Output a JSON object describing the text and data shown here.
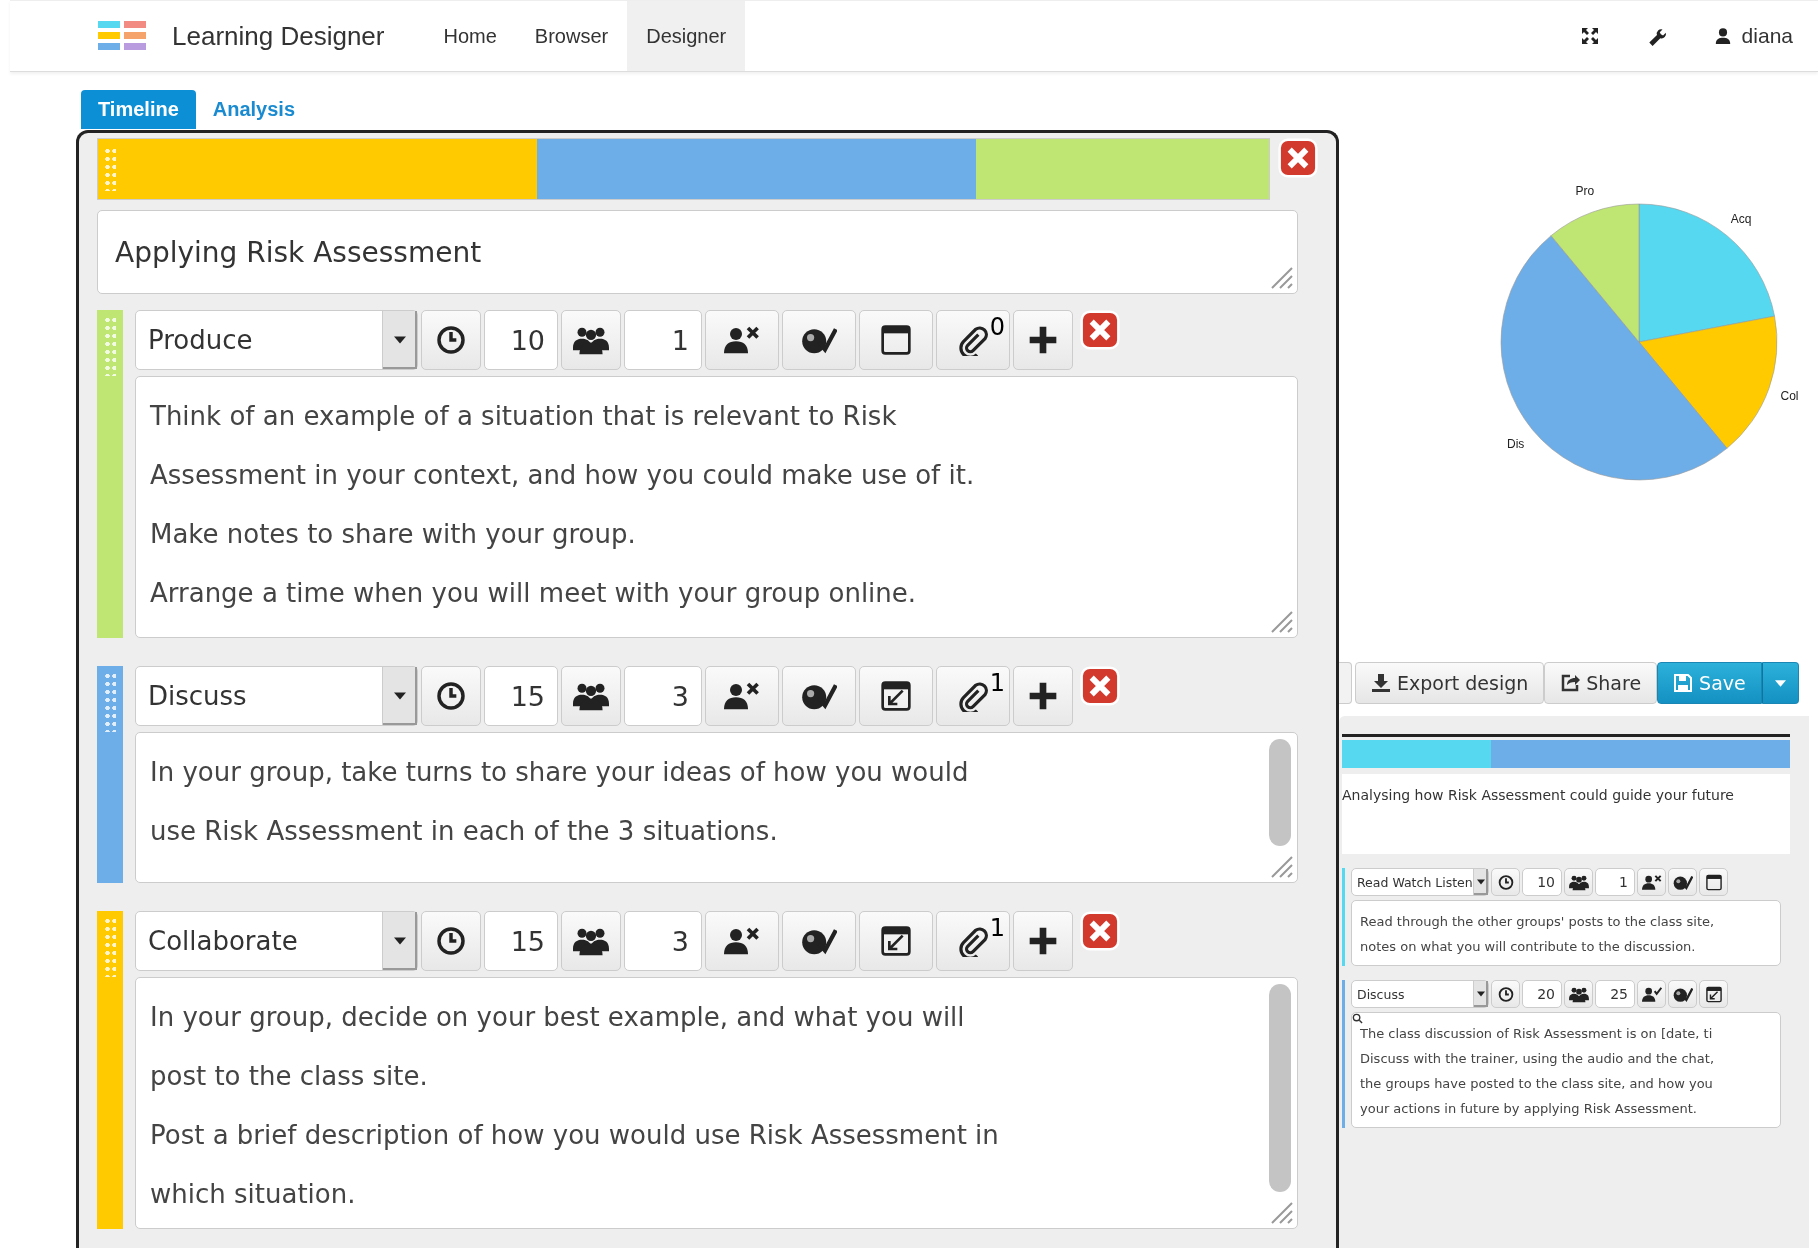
{
  "app": {
    "title": "Learning Designer",
    "user": "diana"
  },
  "nav": [
    {
      "label": "Home",
      "selected": false
    },
    {
      "label": "Browser",
      "selected": false
    },
    {
      "label": "Designer",
      "selected": true
    }
  ],
  "tabs": [
    {
      "label": "Timeline",
      "selected": true
    },
    {
      "label": "Analysis",
      "selected": false
    }
  ],
  "session": {
    "title": "Applying Risk Assessment",
    "activities": [
      {
        "type": "Produce",
        "color": "#bfe672",
        "duration": "10",
        "group": "1",
        "attachments": "0",
        "learner_check": false,
        "calendar_edit": false,
        "scrollable": false,
        "lines": [
          "Think of an example of a situation that is relevant to Risk",
          "Assessment in your context, and how you could make use of it.",
          "Make notes to share with your group.",
          "Arrange a time when you will meet with your group online."
        ]
      },
      {
        "type": "Discuss",
        "color": "#6eaee8",
        "duration": "15",
        "group": "3",
        "attachments": "1",
        "learner_check": false,
        "calendar_edit": true,
        "scrollable": true,
        "lines": [
          "In your group, take turns to share your ideas of how you would",
          "use Risk Assessment in each of the 3 situations."
        ]
      },
      {
        "type": "Collaborate",
        "color": "#ffca00",
        "duration": "15",
        "group": "3",
        "attachments": "1",
        "learner_check": false,
        "calendar_edit": true,
        "scrollable": true,
        "lines": [
          "In your group, decide on your best example, and what you will",
          "post to the class site.",
          "Post a brief description of how you would use Risk Assessment in",
          "which situation."
        ]
      }
    ]
  },
  "chart_data": {
    "type": "pie",
    "categories": [
      "Acq",
      "Col",
      "Dis",
      "Pro"
    ],
    "colors": [
      "#55d8f0",
      "#ffca00",
      "#6eaee8",
      "#bfe672"
    ],
    "values": [
      22,
      17,
      50,
      11
    ]
  },
  "actions": [
    {
      "label": "Export design",
      "kind": "export"
    },
    {
      "label": "Share",
      "kind": "share"
    },
    {
      "label": "Save",
      "kind": "save"
    }
  ],
  "preview": {
    "title": "Analysing how Risk Assessment could guide your future",
    "activities": [
      {
        "type": "Read Watch Listen",
        "color": "#55d8f0",
        "duration": "10",
        "group": "1",
        "learner_check": false,
        "calendar_edit": false,
        "annotated": false,
        "lines": [
          "Read through the other groups' posts to the class site,",
          "notes on what you will contribute to the discussion."
        ]
      },
      {
        "type": "Discuss",
        "color": "#6eaee8",
        "duration": "20",
        "group": "25",
        "learner_check": true,
        "calendar_edit": true,
        "annotated": true,
        "lines": [
          "The class discussion of Risk Assessment is on [date, ti",
          "Discuss with the trainer, using the audio and the chat,",
          "the groups have posted to the class site, and how you",
          "your actions in future by applying Risk Assessment."
        ]
      }
    ]
  }
}
